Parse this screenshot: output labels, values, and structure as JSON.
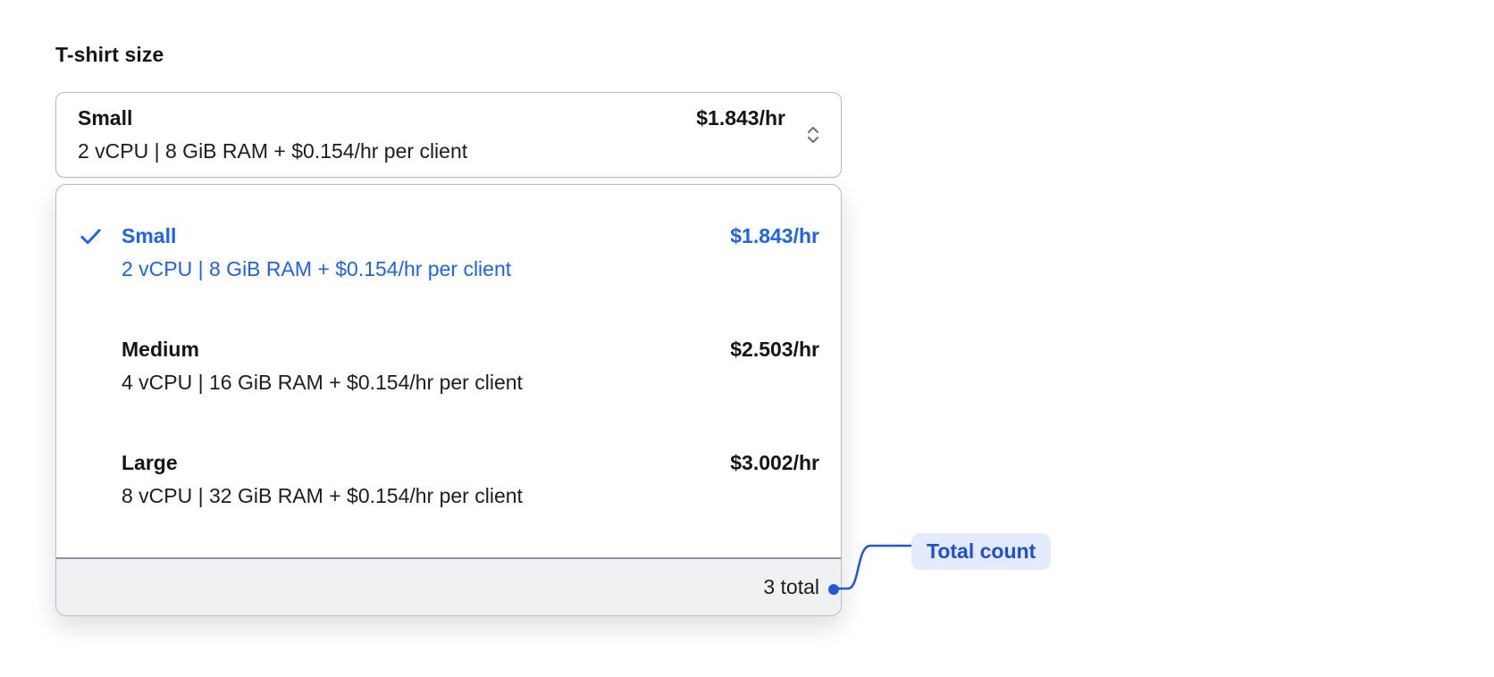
{
  "field_label": "T-shirt size",
  "trigger": {
    "title": "Small",
    "description": "2 vCPU | 8 GiB RAM + $0.154/hr per client",
    "price": "$1.843/hr"
  },
  "dropdown": {
    "options": [
      {
        "title": "Small",
        "description": "2 vCPU | 8 GiB RAM + $0.154/hr per client",
        "price": "$1.843/hr",
        "selected": true
      },
      {
        "title": "Medium",
        "description": "4 vCPU | 16 GiB RAM + $0.154/hr per client",
        "price": "$2.503/hr",
        "selected": false
      },
      {
        "title": "Large",
        "description": "8 vCPU | 32 GiB RAM + $0.154/hr per client",
        "price": "$3.002/hr",
        "selected": false
      }
    ],
    "footer": {
      "total": "3 total"
    }
  },
  "annotation": {
    "label": "Total count"
  },
  "colors": {
    "selected_blue": "#1c63f2",
    "annotation_text": "#1d4fd8",
    "annotation_bg": "#e3ebfc",
    "connector_blue": "#2157e0",
    "footer_bg": "#f0f1f3",
    "divider": "#8b93a1",
    "border": "#b5bac4",
    "text": "#141519",
    "chevron_gray": "#6f7680"
  }
}
